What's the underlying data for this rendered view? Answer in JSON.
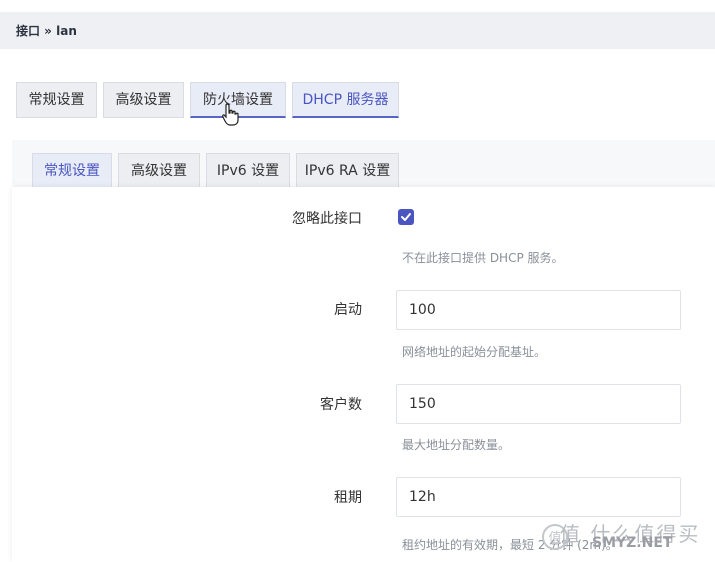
{
  "breadcrumb": "接口 » lan",
  "outer_tabs": [
    {
      "label": "常规设置"
    },
    {
      "label": "高级设置"
    },
    {
      "label": "防火墙设置"
    },
    {
      "label": "DHCP 服务器"
    }
  ],
  "inner_tabs": [
    {
      "label": "常规设置"
    },
    {
      "label": "高级设置"
    },
    {
      "label": "IPv6 设置"
    },
    {
      "label": "IPv6 RA 设置"
    }
  ],
  "form": {
    "ignore": {
      "label": "忽略此接口",
      "checked": true,
      "hint": "不在此接口提供 DHCP 服务。"
    },
    "start": {
      "label": "启动",
      "value": "100",
      "hint": "网络地址的起始分配基址。"
    },
    "limit": {
      "label": "客户数",
      "value": "150",
      "hint": "最大地址分配数量。"
    },
    "leasetime": {
      "label": "租期",
      "value": "12h",
      "hint": "租约地址的有效期，最短 2 分钟 (2m)。"
    }
  },
  "watermark": {
    "line1": "值 什么值得买",
    "line2": "SMYZ.NET"
  },
  "colors": {
    "accent": "#4a55c0",
    "tab_bg": "#eceef1",
    "active_tab_bg": "#e8ecf7"
  }
}
